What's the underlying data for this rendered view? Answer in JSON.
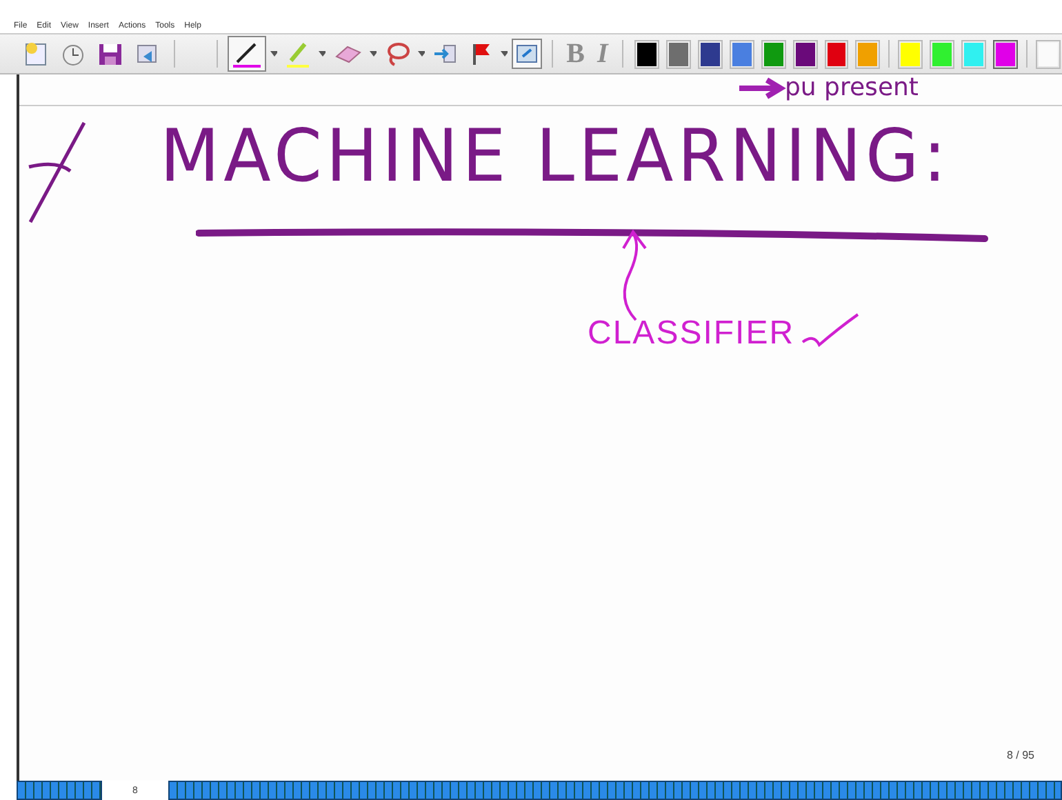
{
  "menu": [
    "File",
    "Edit",
    "View",
    "Insert",
    "Actions",
    "Tools",
    "Help"
  ],
  "tools": [
    {
      "kind": "new"
    },
    {
      "kind": "history"
    },
    {
      "kind": "save"
    },
    {
      "kind": "mail"
    },
    {
      "kind": "pen",
      "selected": true
    },
    {
      "kind": "highlighter",
      "selected": false
    },
    {
      "kind": "eraser",
      "selected": false
    },
    {
      "kind": "lasso",
      "selected": false
    },
    {
      "kind": "insert",
      "selected": false
    },
    {
      "kind": "flag",
      "selected": false
    },
    {
      "kind": "view",
      "selected": true
    }
  ],
  "format": [
    {
      "label": "B",
      "disabled": true
    },
    {
      "label": "I",
      "disabled": true
    }
  ],
  "colors": [
    {
      "color": "#000000",
      "selected": false
    },
    {
      "color": "#6e6e6e",
      "selected": false
    },
    {
      "color": "#2e3a8f",
      "selected": false
    },
    {
      "color": "#4a7fe0",
      "selected": false
    },
    {
      "color": "#109a10",
      "selected": false
    },
    {
      "color": "#6a0a7a",
      "selected": false
    },
    {
      "color": "#e00010",
      "selected": false
    },
    {
      "color": "#f0a000",
      "selected": false
    },
    {
      "color": "#ffff00",
      "selected": false
    },
    {
      "color": "#30f030",
      "selected": false
    },
    {
      "color": "#30f0f0",
      "selected": false
    },
    {
      "color": "#e000e8",
      "selected": true
    }
  ],
  "note": {
    "top_line": "pu present",
    "title": "MACHINE LEARNING:",
    "label": "CLASSIFIER"
  },
  "page_indicator": "8 / 95",
  "page_strip": {
    "current": "8"
  }
}
